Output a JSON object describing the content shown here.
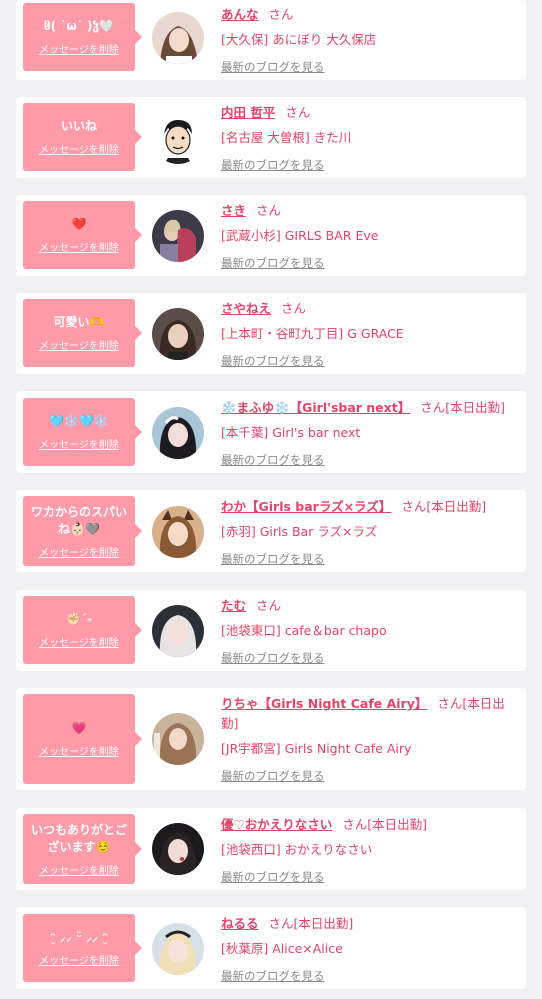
{
  "colors": {
    "accent": "#e2456a",
    "bubble": "#ff9aa9",
    "background": "#f1f1f3",
    "muted": "#8a8a8a"
  },
  "delete_label": "メッセージを削除",
  "blog_label": "最新のブログを見る",
  "san_label": "さん",
  "entries": [
    {
      "message": "ჱ( ˙ω˙ )ჴ🤍",
      "name": "あんな",
      "status": "",
      "shop": "[大久保] あにぼり 大久保店"
    },
    {
      "message": "いいね",
      "name": "内田 哲平",
      "status": "",
      "shop": "[名古屋 大曽根] きた川"
    },
    {
      "message": "❤️",
      "name": "さき",
      "status": "",
      "shop": "[武蔵小杉] GIRLS BAR Eve"
    },
    {
      "message": "可愛い🫶",
      "name": "さやねえ",
      "status": "",
      "shop": "[上本町・谷町九丁目] G GRACE"
    },
    {
      "message": "🩵❄️🩵❄️",
      "name": "❄️まふゆ❄️【Girl'sbar next】",
      "status": "[本日出勤]",
      "shop": "[本千葉] Girl's bar next"
    },
    {
      "message": "ワカからのスパいね👶🏻🩶",
      "name": "わか【Girls barラズ×ラズ】",
      "status": "[本日出勤]",
      "shop": "[赤羽] Girls Bar ラズ×ラズ"
    },
    {
      "message": "✊🏻ˊ-",
      "name": "たむ",
      "status": "",
      "shop": "[池袋東口] cafe＆bar chapo"
    },
    {
      "message": "💗",
      "name": "りちゃ【Girls Night Cafe Airy】",
      "status": "[本日出勤]",
      "shop": "[JR宇都宮] Girls Night Cafe Airy"
    },
    {
      "message": "いつもありがとございます☺️",
      "name": "優♡おかえりなさい",
      "status": "[本日出勤]",
      "shop": "[池袋西口] おかえりなさい"
    },
    {
      "message": "ᵔ̮ ⸝⸝ ᵕ̈ ⸝⸝ ᵔ̮",
      "name": "ねるる",
      "status": "[本日出勤]",
      "shop": "[秋葉原] Alice×Alice"
    }
  ]
}
